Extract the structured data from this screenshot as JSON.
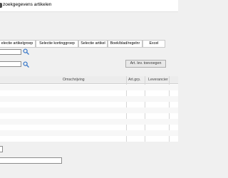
{
  "window": {
    "title": "zoekgegevens artikelen"
  },
  "tabs": [
    {
      "label": "electie artikelgroep"
    },
    {
      "label": "Selectie kortinggroep"
    },
    {
      "label": "Selectie artikel"
    },
    {
      "label": "Boek/blad/regelnr"
    },
    {
      "label": "Excel"
    }
  ],
  "search": {
    "field1_value": "",
    "field2_value": ""
  },
  "buttons": {
    "add_supplier_article": "Art. lev. toevoegen"
  },
  "grid": {
    "columns": [
      {
        "label": "Omschrijving"
      },
      {
        "label": "Art.grp."
      },
      {
        "label": "Leverancier"
      }
    ],
    "rows": []
  },
  "bottom": {
    "input_value": ""
  },
  "icons": {
    "search": "search-icon",
    "app": "app-icon"
  },
  "colors": {
    "search_icon": "#3a78c8",
    "title_background": "#ffffff",
    "window_background": "#f0f0f0"
  }
}
